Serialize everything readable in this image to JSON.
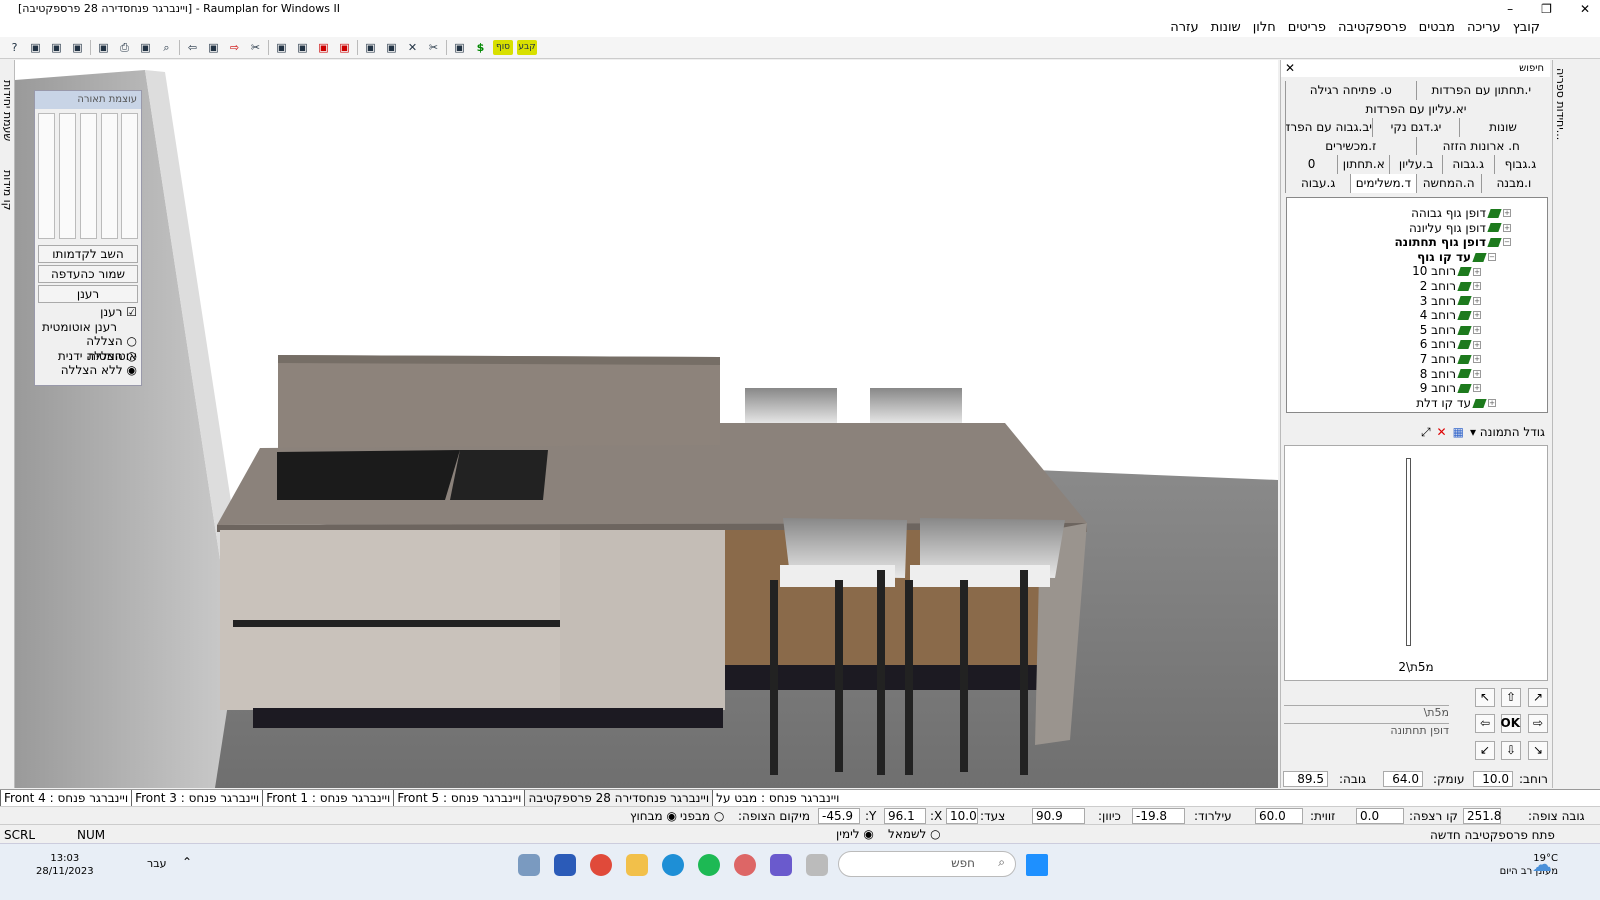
{
  "window": {
    "title": "[ויינברגר פנחסדירה 28 פרספקטיבה] - Raumplan for Windows II",
    "min": "–",
    "max": "❐",
    "close": "✕"
  },
  "menu": [
    "קובץ",
    "עריכה",
    "מבטים",
    "פרספקטיבה",
    "פריטים",
    "חלון",
    "שונות",
    "עזרה"
  ],
  "toolbar_icons": [
    "help-icon",
    "import-icon",
    "export-icon",
    "box-icon",
    "grid-icon",
    "print-icon",
    "measure-icon",
    "zoom-icon",
    "undo-arrow-icon",
    "wall-icon",
    "redo-arrow-icon",
    "cut-icon",
    "cabinet-icon",
    "cabinet2-icon",
    "red-cabinet-icon",
    "red-cabinet2-icon",
    "color-icon",
    "add-icon",
    "delete-icon",
    "scissors-icon",
    "tools-icon",
    "dollar-icon"
  ],
  "toolbar_text": {
    "dollar": "$",
    "end": "סוף",
    "fix": "קבע"
  },
  "light_panel": {
    "title": "עוצמת תאורה",
    "reset": "השב לקדמותו",
    "save": "שמור כהעדפה",
    "refresh": "רענן",
    "auto_refresh": "רענן אוטומטית",
    "options": [
      "הצללה אוטומטית",
      "הצללה ידנית",
      "ללא הצללה"
    ],
    "selected_option": "ללא הצללה"
  },
  "left_tabs": [
    "שעמת יחידות",
    "קו מידות"
  ],
  "right_panel": {
    "search": "חיפוש",
    "tab_rows": [
      [
        "י.תחתון עם הפרדות",
        "ט. פתיחה רגילה"
      ],
      [
        "יא.עליון עם הפרדות"
      ],
      [
        "שונות",
        "יג.דגם נקי",
        "יב.גבוה עם הפרדות"
      ],
      [
        "ח. ארונות הזזה",
        "ז.מכשירים"
      ],
      [
        "ג.גבוף",
        "ג.גבוה",
        "ב.עליון",
        "א.תחתון",
        "0"
      ],
      [
        "ו.מבנה",
        "ה.המחשה",
        "ד.משלימים",
        "ג.עבוה"
      ]
    ],
    "tree": [
      {
        "label": "דופן גוף גבוהה",
        "level": 0
      },
      {
        "label": "דופן גוף עליונה",
        "level": 0
      },
      {
        "label": "דופן גוף תחתונה",
        "level": 0,
        "bold": true
      },
      {
        "label": "עד קו גוף",
        "level": 1,
        "bold": true
      },
      {
        "label": "רוחב 10",
        "level": 2
      },
      {
        "label": "רוחב 2",
        "level": 2
      },
      {
        "label": "רוחב 3",
        "level": 2
      },
      {
        "label": "רוחב 4",
        "level": 2
      },
      {
        "label": "רוחב 5",
        "level": 2
      },
      {
        "label": "רוחב 6",
        "level": 2
      },
      {
        "label": "רוחב 7",
        "level": 2
      },
      {
        "label": "רוחב 8",
        "level": 2
      },
      {
        "label": "רוחב 9",
        "level": 2
      },
      {
        "label": "עד קו דלת",
        "level": 1
      }
    ],
    "picture_size": "גודל התמונה",
    "preview_caption": "מ5ת\\2",
    "path": "\\מ5ת",
    "item_name": "דופן תחתונה",
    "ok": "OK",
    "dims": {
      "width_label": "רוחב:",
      "width": "10.0",
      "depth_label": "עומק:",
      "depth": "64.0",
      "height_label": "גובה:",
      "height": "89.5"
    }
  },
  "far_right_tab": "יחידות ספריה...",
  "doc_tabs": [
    "ויינברגר פנחס : מבט על",
    "ויינברגר פנחסדירה 28 פרספקטיבה",
    "ויינברגר פנחס : Front 5",
    "ויינברגר פנחס : Front 1",
    "ויינברגר פנחס : Front 3",
    "ויינברגר פנחס : Front 4"
  ],
  "status": {
    "eye_height_label": "גובה צופה:",
    "eye_height": "251.8",
    "floor_label": "קו רצפה:",
    "floor": "0.0",
    "angle_label": "זווית:",
    "angle": "60.0",
    "tilt_label": "עילרוד:",
    "tilt": "-19.8",
    "dir_label": "כיוון:",
    "dir": "90.9",
    "step_label": "צעד:",
    "step": "10.0",
    "x_label": "X:",
    "x": "96.1",
    "y_label": "Y:",
    "y": "-45.9",
    "viewer_label": "מיקום הצופה:",
    "inside": "מבפני",
    "outside": "מבחוץ",
    "left": "לשמאל",
    "right": "לימין",
    "new_persp": "פתח פרספקטיבה חדשה",
    "scrl": "SCRL",
    "num": "NUM"
  },
  "taskbar": {
    "time": "13:03",
    "date": "28/11/2023",
    "lang": "עבר",
    "search": "חפש",
    "weather_temp": "19°C",
    "weather_desc": "מעונן רב היום"
  }
}
